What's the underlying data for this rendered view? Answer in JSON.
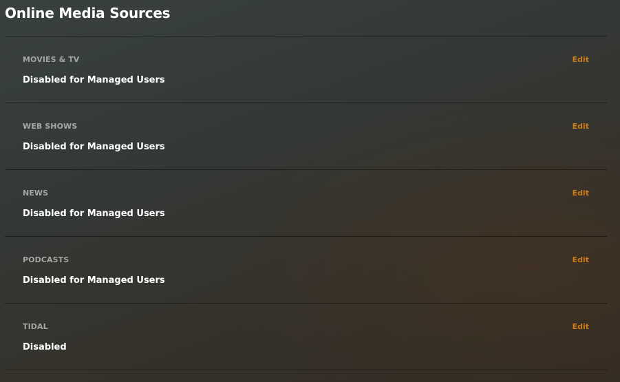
{
  "page": {
    "title": "Online Media Sources"
  },
  "sources": [
    {
      "name": "MOVIES & TV",
      "status": "Disabled for Managed Users",
      "edit_label": "Edit"
    },
    {
      "name": "WEB SHOWS",
      "status": "Disabled for Managed Users",
      "edit_label": "Edit"
    },
    {
      "name": "NEWS",
      "status": "Disabled for Managed Users",
      "edit_label": "Edit"
    },
    {
      "name": "PODCASTS",
      "status": "Disabled for Managed Users",
      "edit_label": "Edit"
    },
    {
      "name": "TIDAL",
      "status": "Disabled",
      "edit_label": "Edit"
    }
  ],
  "colors": {
    "accent": "#cc7b19",
    "label": "#a3a5a4",
    "text": "#ffffff"
  }
}
